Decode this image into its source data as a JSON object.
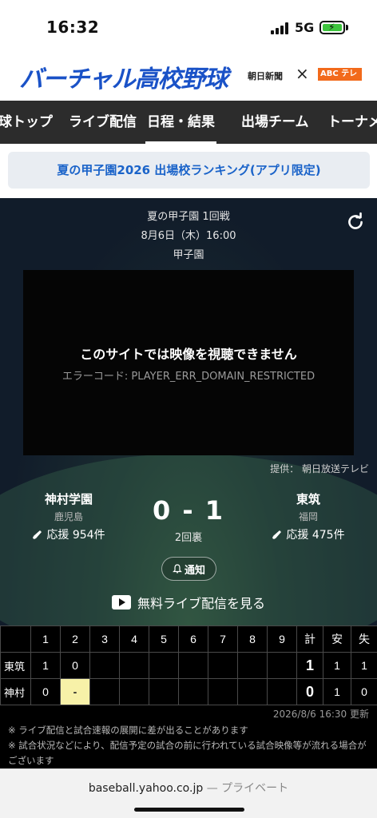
{
  "status": {
    "time": "16:32",
    "network": "5G"
  },
  "header": {
    "logo_text": "バーチャル高校野球",
    "partner_asahi": "朝日新聞",
    "partner_x": "×",
    "partner_abc": "ABC テレビ",
    "colors": {
      "logo": "#1a52c7",
      "abc": "#f26a1b"
    }
  },
  "nav": {
    "items": [
      {
        "label": "球トップ"
      },
      {
        "label": "ライブ配信"
      },
      {
        "label": "日程・結果"
      },
      {
        "label": "出場チーム"
      },
      {
        "label": "トーナメ"
      }
    ],
    "active_index": 2
  },
  "banner": {
    "label": "夏の甲子園2026 出場校ランキング(アプリ限定)"
  },
  "game": {
    "round": "夏の甲子園 1回戦",
    "datetime": "8月6日（木）16:00",
    "venue": "甲子園",
    "video_message": "このサイトでは映像を視聴できません",
    "video_error": "エラーコード: PLAYER_ERR_DOMAIN_RESTRICTED",
    "provider": "提供： 朝日放送テレビ",
    "home": {
      "name": "神村学園",
      "prefecture": "鹿児島",
      "cheer": "応援 954件"
    },
    "away": {
      "name": "東筑",
      "prefecture": "福岡",
      "cheer": "応援 475件"
    },
    "score": "0 - 1",
    "inning": "2回裏",
    "notify_label": "通知",
    "live_label": "無料ライブ配信を見る"
  },
  "scoreboard": {
    "headers": [
      "",
      "1",
      "2",
      "3",
      "4",
      "5",
      "6",
      "7",
      "8",
      "9",
      "計",
      "安",
      "失"
    ],
    "rows": [
      {
        "team": "東筑",
        "innings": [
          "1",
          "0",
          "",
          "",
          "",
          "",
          "",
          "",
          ""
        ],
        "total": "1",
        "hits": "1",
        "errors": "1"
      },
      {
        "team": "神村",
        "innings": [
          "0",
          "-",
          "",
          "",
          "",
          "",
          "",
          "",
          ""
        ],
        "total": "0",
        "hits": "1",
        "errors": "0"
      }
    ],
    "updated": "2026/8/6 16:30 更新",
    "current_color": "#f7f1a8"
  },
  "notes": {
    "line1": "※ ライブ配信と試合速報の展開に差が出ることがあります",
    "line2": "※ 試合状況などにより、配信予定の試合の前に行われている試合映像等が流れる場合がございます"
  },
  "browser": {
    "domain": "baseball.yahoo.co.jp",
    "separator": "—",
    "privacy": "プライベート"
  }
}
